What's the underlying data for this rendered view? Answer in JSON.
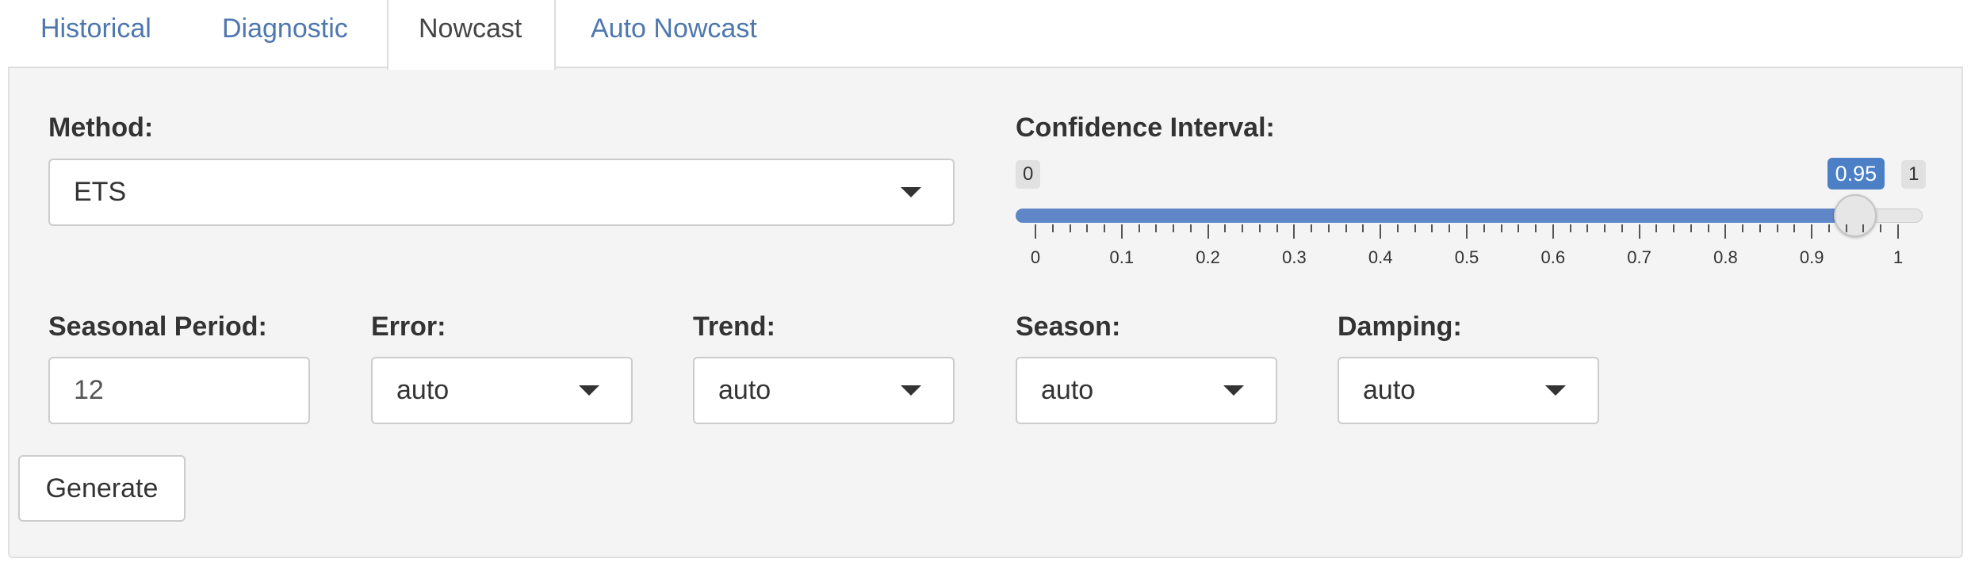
{
  "tabs": [
    {
      "label": "Historical",
      "active": false
    },
    {
      "label": "Diagnostic",
      "active": false
    },
    {
      "label": "Nowcast",
      "active": true
    },
    {
      "label": "Auto Nowcast",
      "active": false
    }
  ],
  "method": {
    "label": "Method:",
    "value": "ETS"
  },
  "confidence": {
    "label": "Confidence Interval:",
    "min": "0",
    "max": "1",
    "value": "0.95",
    "fraction": 0.95,
    "tick_labels": [
      "0",
      "0.1",
      "0.2",
      "0.3",
      "0.4",
      "0.5",
      "0.6",
      "0.7",
      "0.8",
      "0.9",
      "1"
    ]
  },
  "seasonal_period": {
    "label": "Seasonal Period:",
    "value": "12"
  },
  "error": {
    "label": "Error:",
    "value": "auto"
  },
  "trend": {
    "label": "Trend:",
    "value": "auto"
  },
  "season": {
    "label": "Season:",
    "value": "auto"
  },
  "damping": {
    "label": "Damping:",
    "value": "auto"
  },
  "generate_button": {
    "label": "Generate"
  },
  "colors": {
    "accent": "#4b7fc6",
    "link": "#4e77b0",
    "panel_bg": "#f4f4f4"
  },
  "icons": {
    "dropdown": "caret-down-icon"
  }
}
